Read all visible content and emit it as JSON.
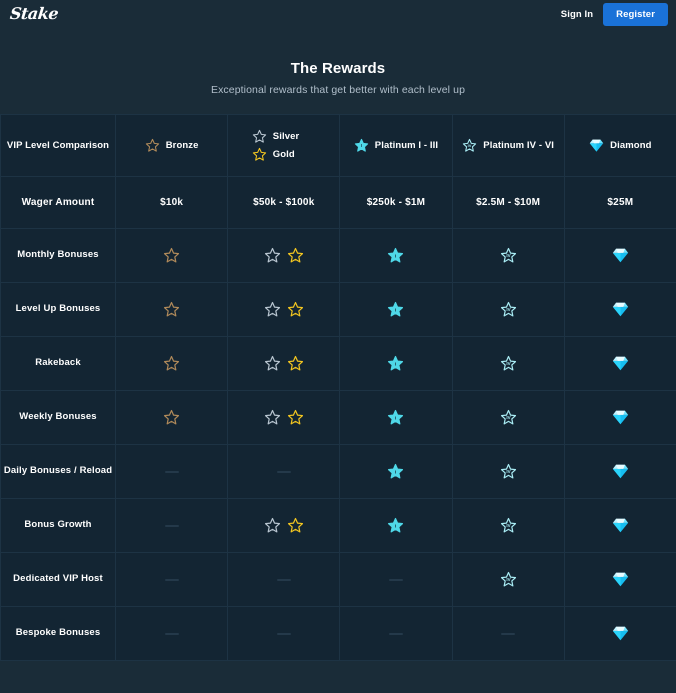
{
  "header": {
    "logo_text": "Stake",
    "sign_in_label": "Sign In",
    "register_label": "Register",
    "register_color": "#1a72d8"
  },
  "hero": {
    "title": "The Rewards",
    "subtitle": "Exceptional rewards that get better with each level up"
  },
  "table": {
    "corner_label": "VIP Level Comparison",
    "columns": [
      {
        "id": "bronze",
        "label": "Bronze",
        "icon": "star-outline-bronze-icon",
        "color": "#b08a5a"
      },
      {
        "id": "silvergold",
        "labels": [
          "Silver",
          "Gold"
        ],
        "icons": [
          "star-outline-silver-icon",
          "star-outline-gold-icon"
        ],
        "colors": [
          "#b9c6d1",
          "#f3c620"
        ]
      },
      {
        "id": "plat13",
        "label": "Platinum I - III",
        "icon": "star-filled-platinum-i-icon",
        "color": "#4fd8e8"
      },
      {
        "id": "plat46",
        "label": "Platinum IV - VI",
        "icon": "star-outline-platinum-iv-icon",
        "color": "#a9ecf4"
      },
      {
        "id": "diamond",
        "label": "Diamond",
        "icon": "diamond-gem-icon",
        "color": "#35d2f5"
      }
    ],
    "wager_row": {
      "label": "Wager Amount",
      "values": [
        "$10k",
        "$50k - $100k",
        "$250k - $1M",
        "$2.5M - $10M",
        "$25M"
      ]
    },
    "rows": [
      {
        "label": "Monthly Bonuses",
        "cells": [
          "bronze",
          "silvergold",
          "plat13",
          "plat46",
          "diamond"
        ]
      },
      {
        "label": "Level Up Bonuses",
        "cells": [
          "bronze",
          "silvergold",
          "plat13",
          "plat46",
          "diamond"
        ]
      },
      {
        "label": "Rakeback",
        "cells": [
          "bronze",
          "silvergold",
          "plat13",
          "plat46",
          "diamond"
        ]
      },
      {
        "label": "Weekly Bonuses",
        "cells": [
          "bronze",
          "silvergold",
          "plat13",
          "plat46",
          "diamond"
        ]
      },
      {
        "label": "Daily Bonuses / Reload",
        "cells": [
          "none",
          "none",
          "plat13",
          "plat46",
          "diamond"
        ]
      },
      {
        "label": "Bonus Growth",
        "cells": [
          "none",
          "silvergold",
          "plat13",
          "plat46",
          "diamond"
        ]
      },
      {
        "label": "Dedicated VIP Host",
        "cells": [
          "none",
          "none",
          "none",
          "plat46",
          "diamond"
        ]
      },
      {
        "label": "Bespoke Bonuses",
        "cells": [
          "none",
          "none",
          "none",
          "none",
          "diamond"
        ]
      }
    ]
  }
}
